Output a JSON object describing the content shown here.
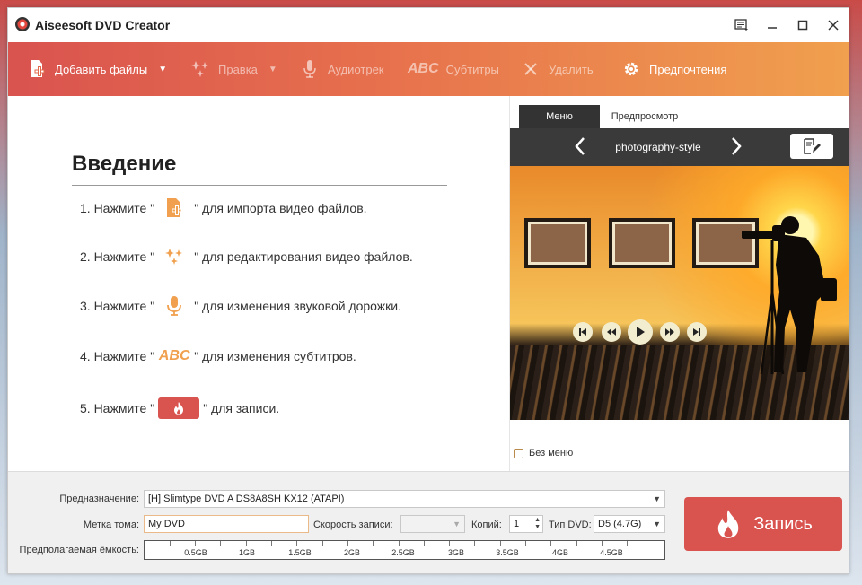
{
  "window": {
    "title": "Aiseesoft DVD Creator"
  },
  "toolbar": {
    "add_files": "Добавить файлы",
    "edit": "Правка",
    "audio": "Аудиотрек",
    "subtitles": "Субтитры",
    "delete": "Удалить",
    "preferences": "Предпочтения"
  },
  "intro": {
    "title": "Введение",
    "steps": [
      {
        "pre": "1. Нажмите \"",
        "post": "\" для импорта видео файлов."
      },
      {
        "pre": "2. Нажмите \"",
        "post": "\" для редактирования видео файлов."
      },
      {
        "pre": "3. Нажмите \"",
        "post": "\" для изменения звуковой дорожки."
      },
      {
        "pre": "4. Нажмите \"",
        "post": "\" для изменения субтитров."
      },
      {
        "pre": "5. Нажмите \"",
        "post": "\" для записи."
      }
    ],
    "abc_glyph": "ABC"
  },
  "preview_panel": {
    "tab_menu": "Меню",
    "tab_preview": "Предпросмотр",
    "menu_name": "photography-style",
    "no_menu": "Без меню"
  },
  "bottom": {
    "destination_label": "Предназначение:",
    "destination_value": "[H] Slimtype DVD A  DS8A8SH KX12 (ATAPI)",
    "volume_label": "Метка тома:",
    "volume_value": "My DVD",
    "speed_label": "Скорость записи:",
    "speed_value": "",
    "copies_label": "Копий:",
    "copies_value": "1",
    "dvd_type_label": "Тип DVD:",
    "dvd_type_value": "D5 (4.7G)",
    "capacity_label": "Предполагаемая ёмкость:",
    "capacity_ticks": [
      "0.5GB",
      "1GB",
      "1.5GB",
      "2GB",
      "2.5GB",
      "3GB",
      "3.5GB",
      "4GB",
      "4.5GB"
    ],
    "burn_label": "Запись"
  },
  "colors": {
    "accent": "#d9534f",
    "toolbar_end": "#f0a04e",
    "icon_orange": "#f0a04e"
  }
}
